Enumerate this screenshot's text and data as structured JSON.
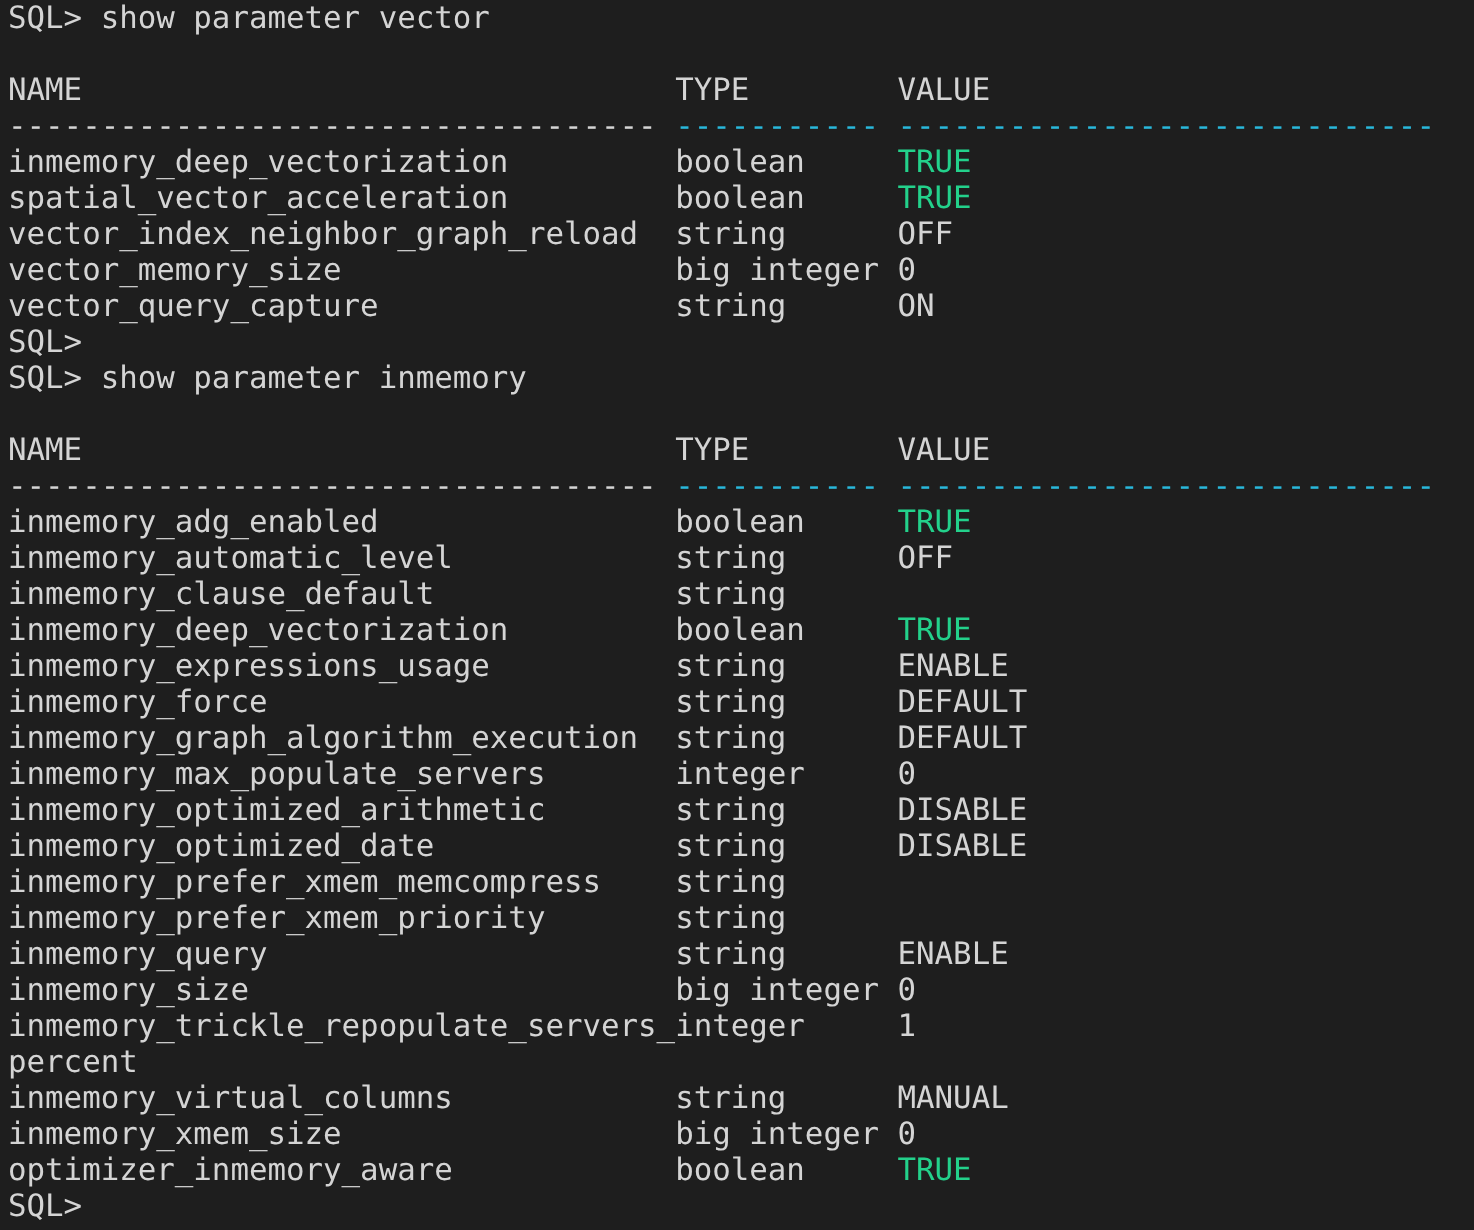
{
  "lines": [
    {
      "kind": "prompt",
      "text": "SQL> show parameter vector"
    },
    {
      "kind": "blank"
    },
    {
      "kind": "header",
      "cells": [
        "NAME",
        "TYPE",
        "VALUE"
      ]
    },
    {
      "kind": "separator",
      "cells": [
        {
          "text": "-----------------------------------",
          "color": "#d4d4d4"
        },
        {
          "text": "-----------",
          "color": "#29b8db"
        },
        {
          "text": "-----------------------------",
          "color": "#29b8db"
        }
      ]
    },
    {
      "kind": "row",
      "name": "inmemory_deep_vectorization",
      "type": "boolean",
      "value": "TRUE",
      "color": "#23d18b"
    },
    {
      "kind": "row",
      "name": "spatial_vector_acceleration",
      "type": "boolean",
      "value": "TRUE",
      "color": "#23d18b"
    },
    {
      "kind": "row",
      "name": "vector_index_neighbor_graph_reload",
      "type": "string",
      "value": "OFF",
      "color": "#d4d4d4"
    },
    {
      "kind": "row",
      "name": "vector_memory_size",
      "type": "big integer",
      "value": "0",
      "color": "#d4d4d4"
    },
    {
      "kind": "row",
      "name": "vector_query_capture",
      "type": "string",
      "value": "ON",
      "color": "#d4d4d4"
    },
    {
      "kind": "prompt",
      "text": "SQL>"
    },
    {
      "kind": "prompt",
      "text": "SQL> show parameter inmemory"
    },
    {
      "kind": "blank"
    },
    {
      "kind": "header",
      "cells": [
        "NAME",
        "TYPE",
        "VALUE"
      ]
    },
    {
      "kind": "separator",
      "cells": [
        {
          "text": "-----------------------------------",
          "color": "#d4d4d4"
        },
        {
          "text": "-----------",
          "color": "#29b8db"
        },
        {
          "text": "-----------------------------",
          "color": "#29b8db"
        }
      ]
    },
    {
      "kind": "row",
      "name": "inmemory_adg_enabled",
      "type": "boolean",
      "value": "TRUE",
      "color": "#23d18b"
    },
    {
      "kind": "row",
      "name": "inmemory_automatic_level",
      "type": "string",
      "value": "OFF",
      "color": "#d4d4d4"
    },
    {
      "kind": "row",
      "name": "inmemory_clause_default",
      "type": "string"
    },
    {
      "kind": "row",
      "name": "inmemory_deep_vectorization",
      "type": "boolean",
      "value": "TRUE",
      "color": "#23d18b"
    },
    {
      "kind": "row",
      "name": "inmemory_expressions_usage",
      "type": "string",
      "value": "ENABLE",
      "color": "#d4d4d4"
    },
    {
      "kind": "row",
      "name": "inmemory_force",
      "type": "string",
      "value": "DEFAULT",
      "color": "#d4d4d4"
    },
    {
      "kind": "row",
      "name": "inmemory_graph_algorithm_execution",
      "type": "string",
      "value": "DEFAULT",
      "color": "#d4d4d4"
    },
    {
      "kind": "row",
      "name": "inmemory_max_populate_servers",
      "type": "integer",
      "value": "0",
      "color": "#d4d4d4"
    },
    {
      "kind": "row",
      "name": "inmemory_optimized_arithmetic",
      "type": "string",
      "value": "DISABLE",
      "color": "#d4d4d4"
    },
    {
      "kind": "row",
      "name": "inmemory_optimized_date",
      "type": "string",
      "value": "DISABLE",
      "color": "#d4d4d4"
    },
    {
      "kind": "row",
      "name": "inmemory_prefer_xmem_memcompress",
      "type": "string"
    },
    {
      "kind": "row",
      "name": "inmemory_prefer_xmem_priority",
      "type": "string"
    },
    {
      "kind": "row",
      "name": "inmemory_query",
      "type": "string",
      "value": "ENABLE",
      "color": "#d4d4d4"
    },
    {
      "kind": "row",
      "name": "inmemory_size",
      "type": "big integer",
      "value": "0",
      "color": "#d4d4d4"
    },
    {
      "kind": "row",
      "name": "inmemory_trickle_repopulate_servers_",
      "type": "integer",
      "value": "1",
      "color": "#d4d4d4"
    },
    {
      "kind": "continuation",
      "text": "percent"
    },
    {
      "kind": "row",
      "name": "inmemory_virtual_columns",
      "type": "string",
      "value": "MANUAL",
      "color": "#d4d4d4"
    },
    {
      "kind": "row",
      "name": "inmemory_xmem_size",
      "type": "big integer",
      "value": "0",
      "color": "#d4d4d4"
    },
    {
      "kind": "row",
      "name": "optimizer_inmemory_aware",
      "type": "boolean",
      "value": "TRUE",
      "color": "#23d18b"
    },
    {
      "kind": "prompt",
      "text": "SQL>"
    }
  ]
}
